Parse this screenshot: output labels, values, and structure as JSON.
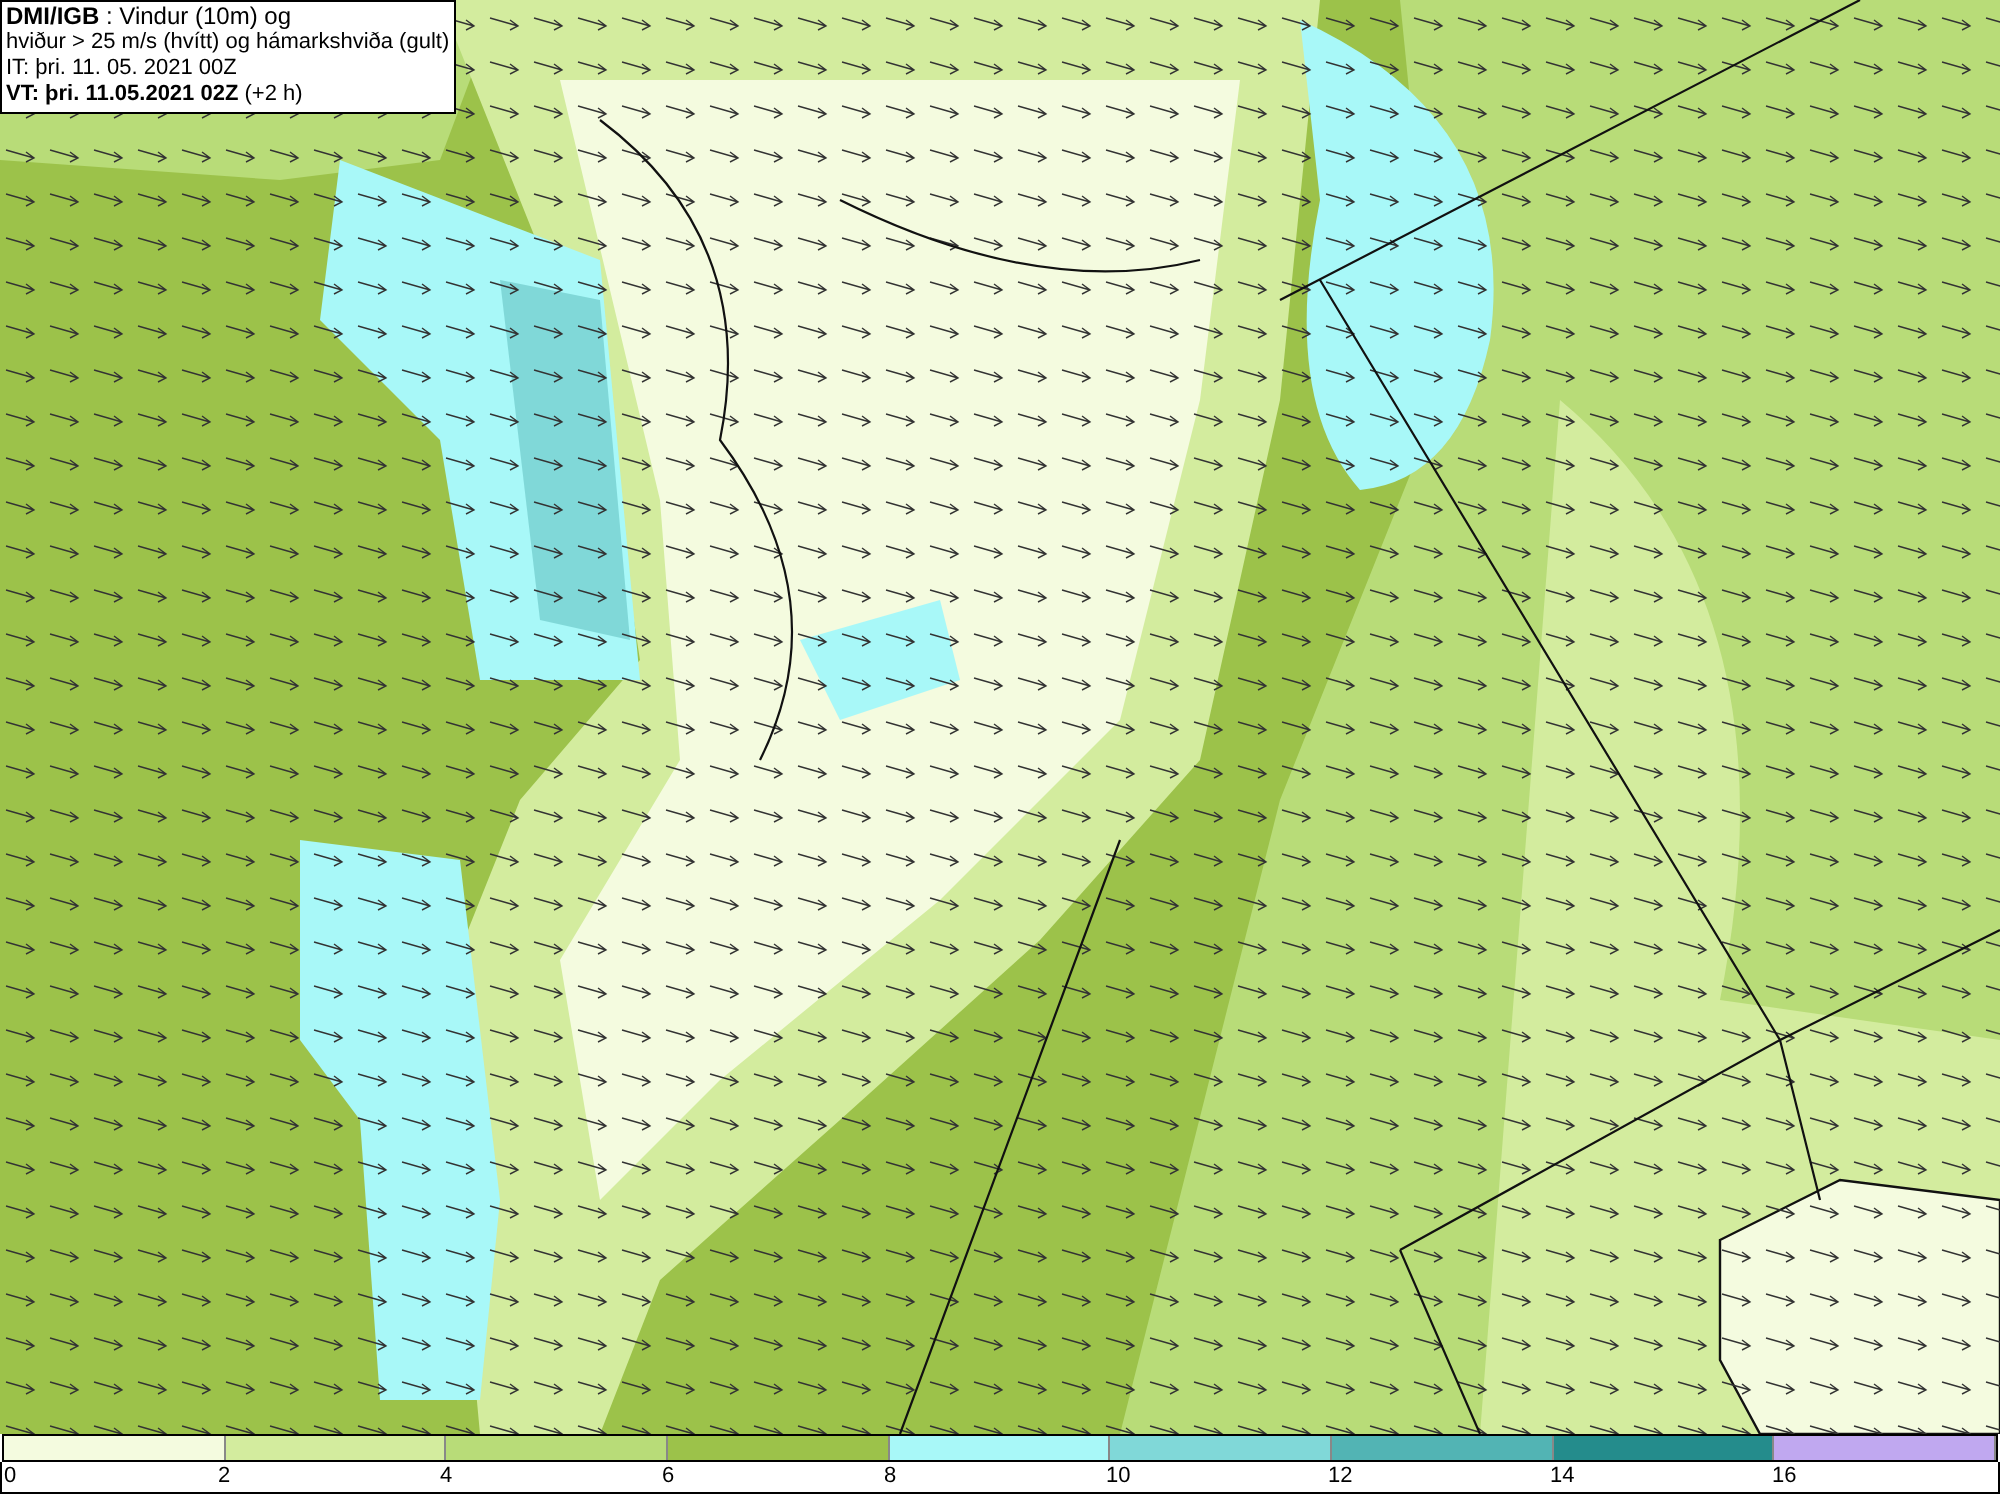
{
  "legend": {
    "lines": [
      "**DMI/IGB** : Vindur (10m) og",
      "hviður > 25 m/s (hvítt) og hámarkshviða (gult)",
      "IT: þri. 11. 05. 2021 00Z",
      "**VT: þri. 11.05.2021 02Z** (+2 h)"
    ]
  },
  "colorbar": {
    "bins": [
      {
        "color": "#f4fbdf"
      },
      {
        "color": "#d3ec9e"
      },
      {
        "color": "#b8dc78"
      },
      {
        "color": "#9cc24a"
      },
      {
        "color": "#a8f8f8"
      },
      {
        "color": "#80d8d8"
      },
      {
        "color": "#52b4b4"
      },
      {
        "color": "#248c8c"
      },
      {
        "color": "#c0a8f0"
      }
    ],
    "ticks": [
      "0",
      "2",
      "4",
      "6",
      "8",
      "10",
      "12",
      "14",
      "16"
    ]
  }
}
